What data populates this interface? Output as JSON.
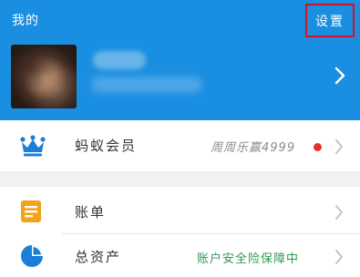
{
  "header": {
    "title": "我的",
    "settings_label": "设置",
    "background": "#1a8ee0",
    "profile": {
      "avatar_icon": "avatar",
      "chevron_icon": "chevron-right-icon"
    }
  },
  "menu": {
    "vip": {
      "label": "蚂蚁会员",
      "hint": "周周乐赢4999",
      "icon": "crown-icon",
      "badge_color": "#e2342d"
    },
    "bill": {
      "label": "账单",
      "icon": "bill-icon"
    },
    "assets": {
      "label": "总资产",
      "hint": "账户安全险保障中",
      "icon": "pie-chart-icon",
      "hint_color": "#2d9a52"
    }
  },
  "colors": {
    "accent_blue": "#1a8ee0",
    "highlight_red": "#d0152a",
    "bill_orange": "#f2a21b"
  }
}
